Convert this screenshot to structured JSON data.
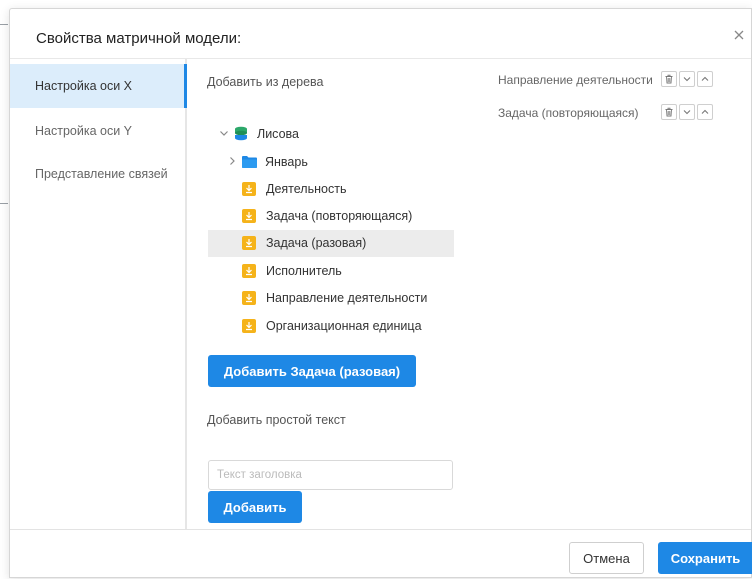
{
  "dialog": {
    "title": "Свойства матричной модели:"
  },
  "sidebar": {
    "items": [
      {
        "label": "Настройка оси X"
      },
      {
        "label": "Настройка оси Y"
      },
      {
        "label": "Представление связей"
      }
    ],
    "active_index": 0
  },
  "tree_section": {
    "heading": "Добавить из дерева",
    "root": "Лисова",
    "folder": "Январь",
    "items": [
      "Деятельность",
      "Задача (повторяющаяся)",
      "Задача (разовая)",
      "Исполнитель",
      "Направление деятельности",
      "Организационная единица"
    ],
    "selected": "Задача (разовая)",
    "add_button_label": "Добавить Задача (разовая)"
  },
  "text_section": {
    "heading": "Добавить простой текст",
    "input_placeholder": "Текст заголовка",
    "input_value": "",
    "add_button_label": "Добавить"
  },
  "axis_list": {
    "items": [
      {
        "label": "Направление деятельности"
      },
      {
        "label": "Задача (повторяющаяся)"
      }
    ]
  },
  "footer": {
    "cancel_label": "Отмена",
    "save_label": "Сохранить"
  },
  "colors": {
    "accent": "#1e88e5",
    "selected_tab_bg": "#dcedfb",
    "object_icon": "#f5b31a",
    "folder_icon": "#1e88e5"
  },
  "icons": {
    "close": "close-icon",
    "expand": "chevron-down-icon",
    "collapse": "chevron-right-icon",
    "database": "database-icon",
    "folder": "folder-icon",
    "object": "object-type-icon",
    "delete": "trash-icon",
    "move_down": "chevron-down-icon",
    "move_up": "chevron-up-icon"
  }
}
